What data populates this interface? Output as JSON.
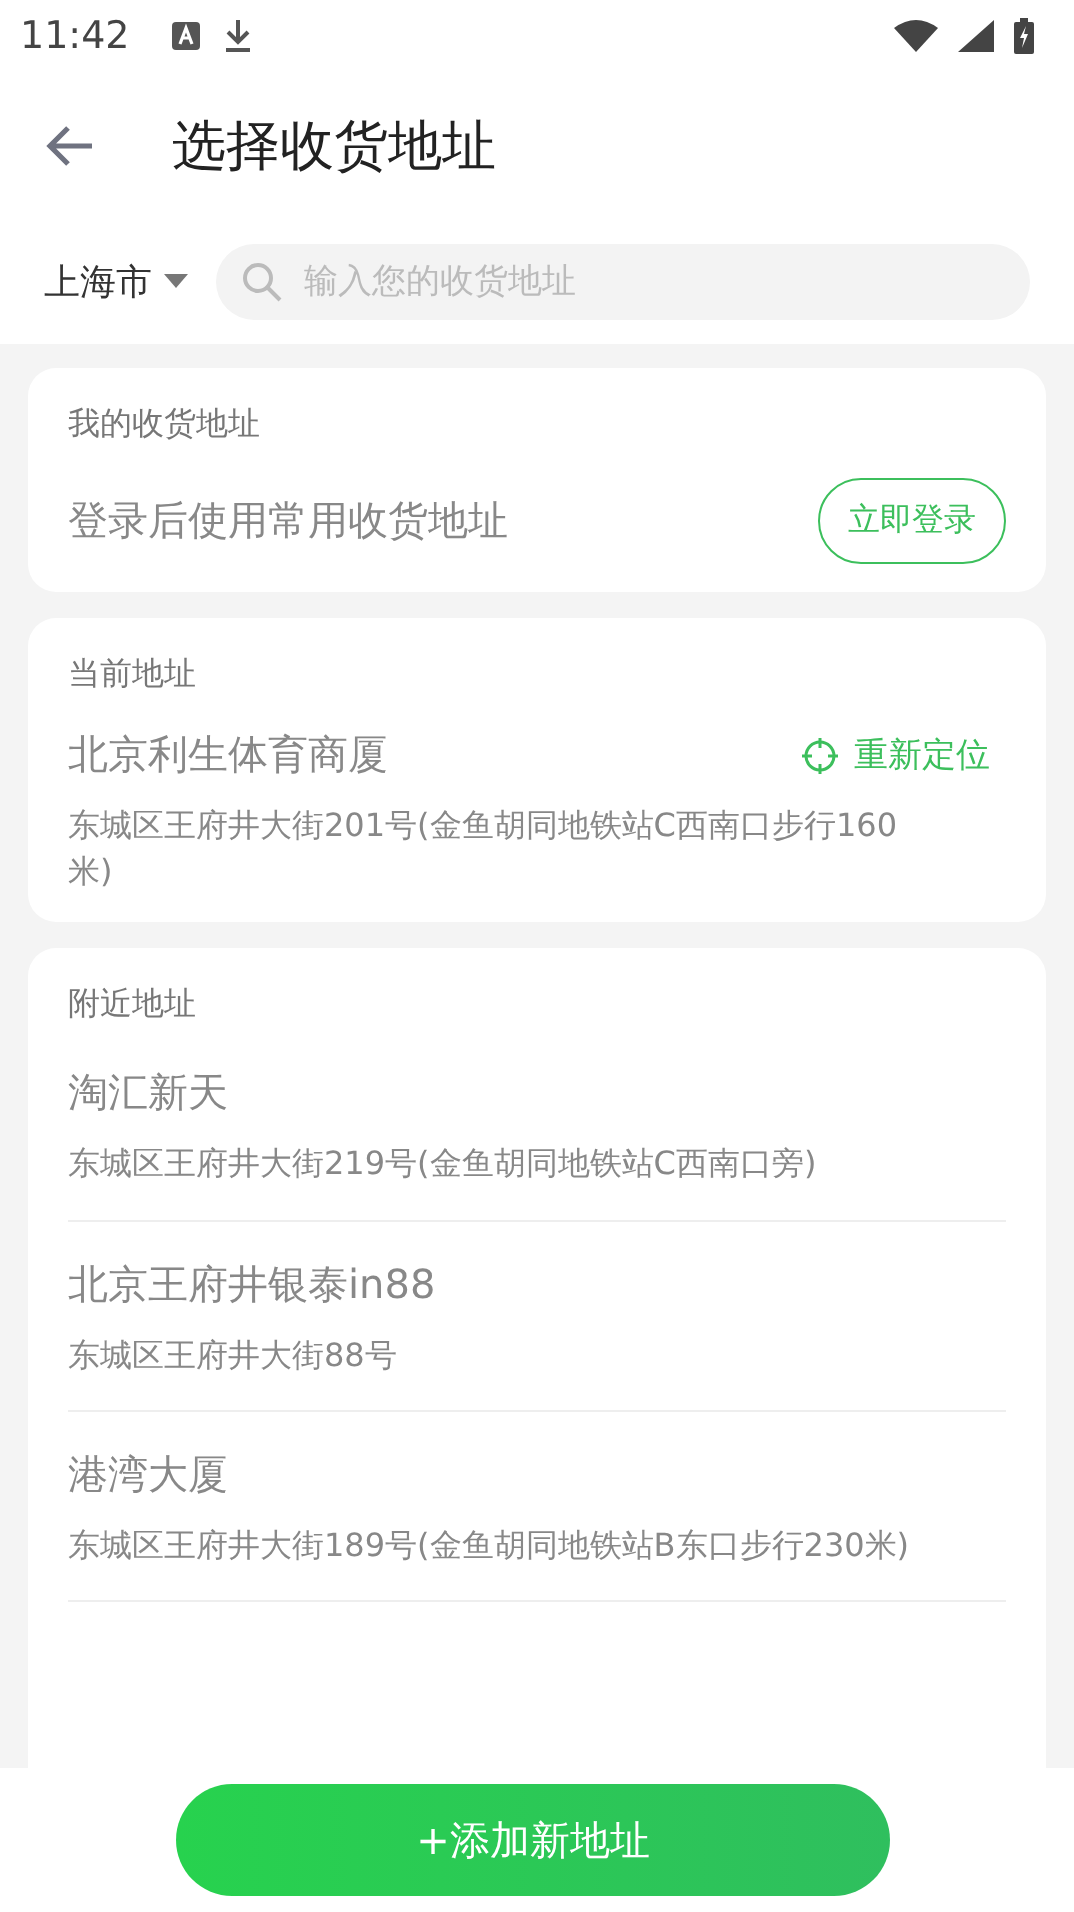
{
  "status_bar": {
    "time": "11:42"
  },
  "header": {
    "title": "选择收货地址"
  },
  "search": {
    "city": "上海市",
    "placeholder": "输入您的收货地址"
  },
  "my_address": {
    "heading": "我的收货地址",
    "hint": "登录后使用常用收货地址",
    "login_button": "立即登录"
  },
  "current_address": {
    "heading": "当前地址",
    "name": "北京利生体育商厦",
    "detail": "东城区王府井大街201号(金鱼胡同地铁站C西南口步行160米)",
    "relocate": "重新定位"
  },
  "nearby": {
    "heading": "附近地址",
    "items": [
      {
        "name": "淘汇新天",
        "detail": "东城区王府井大街219号(金鱼胡同地铁站C西南口旁)"
      },
      {
        "name": "北京王府井银泰in88",
        "detail": "东城区王府井大街88号"
      },
      {
        "name": "港湾大厦",
        "detail": "东城区王府井大街189号(金鱼胡同地铁站B东口步行230米)"
      }
    ]
  },
  "add_button": "+添加新地址"
}
